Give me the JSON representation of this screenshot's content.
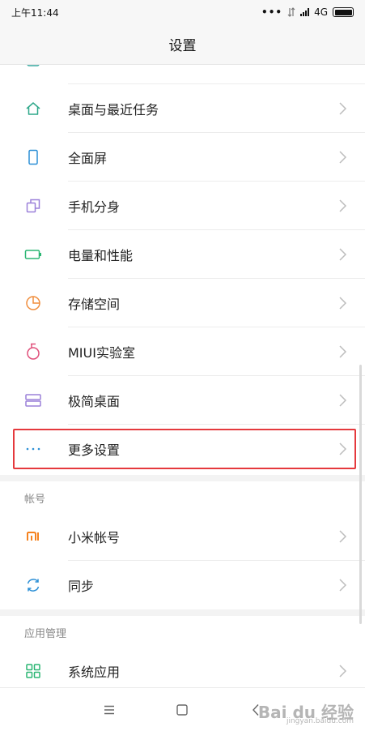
{
  "status_bar": {
    "time": "上午11:44",
    "network": "4G"
  },
  "header": {
    "title": "设置"
  },
  "rows_top": [
    {
      "label": "",
      "icon": "notification-icon",
      "color": "#39a9a0"
    },
    {
      "label": "桌面与最近任务",
      "icon": "home-icon",
      "color": "#2fa88a"
    },
    {
      "label": "全面屏",
      "icon": "phone-screen-icon",
      "color": "#2b8fd6"
    },
    {
      "label": "手机分身",
      "icon": "clone-icon",
      "color": "#9b80d9"
    },
    {
      "label": "电量和性能",
      "icon": "battery-icon",
      "color": "#2bb673"
    },
    {
      "label": "存储空间",
      "icon": "storage-pie-icon",
      "color": "#f08d3c"
    },
    {
      "label": "MIUI实验室",
      "icon": "flask-icon",
      "color": "#e0507b"
    },
    {
      "label": "极简桌面",
      "icon": "simple-desktop-icon",
      "color": "#9b80d9"
    },
    {
      "label": "更多设置",
      "icon": "more-dots-icon",
      "color": "#2b8fd6"
    }
  ],
  "section_account": {
    "title": "帐号",
    "items": [
      {
        "label": "小米帐号",
        "icon": "mi-logo-icon",
        "color": "#f5821f"
      },
      {
        "label": "同步",
        "icon": "sync-icon",
        "color": "#2b8fd6"
      }
    ]
  },
  "section_apps": {
    "title": "应用管理",
    "items": [
      {
        "label": "系统应用",
        "icon": "grid-apps-icon",
        "color": "#2bb673"
      }
    ]
  },
  "watermark": {
    "main": "Bai du 经验",
    "sub": "jingyan.baidu.com"
  },
  "colors": {
    "highlight": "#e5393d",
    "chevron": "#bdbdbd",
    "section_bg": "#f3f3f3"
  }
}
